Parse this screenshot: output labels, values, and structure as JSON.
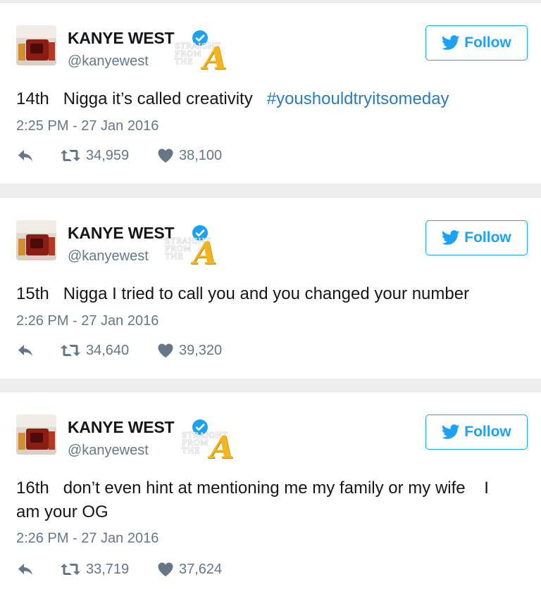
{
  "tweets": [
    {
      "display_name": "KANYE WEST",
      "handle": "@kanyewest",
      "follow_label": "Follow",
      "text_prefix": "14th   Nigga it’s called creativity   ",
      "hashtag": "#youshouldtryitsomeday",
      "timestamp": "2:25 PM - 27 Jan 2016",
      "retweets": "34,959",
      "likes": "38,100"
    },
    {
      "display_name": "KANYE WEST",
      "handle": "@kanyewest",
      "follow_label": "Follow",
      "text_prefix": "15th   Nigga I tried to call you and you changed your number",
      "hashtag": "",
      "timestamp": "2:26 PM - 27 Jan 2016",
      "retweets": "34,640",
      "likes": "39,320"
    },
    {
      "display_name": "KANYE WEST",
      "handle": "@kanyewest",
      "follow_label": "Follow",
      "text_prefix": "16th   don’t even hint at mentioning me my family or my wife    I\nam your OG",
      "hashtag": "",
      "timestamp": "2:26 PM - 27 Jan 2016",
      "retweets": "33,719",
      "likes": "37,624"
    }
  ],
  "watermark": {
    "text": "STRAIGHT\nFROM\nTHE",
    "logo": "A"
  },
  "colors": {
    "twitter_blue": "#1da1f2",
    "hashtag": "#2b7bb9",
    "secondary_text": "#657786",
    "verified": "#1da1f2"
  },
  "icons": {
    "verified": "verified-badge-icon",
    "bird": "twitter-bird-icon",
    "reply": "reply-icon",
    "retweet": "retweet-icon",
    "like": "heart-icon"
  }
}
